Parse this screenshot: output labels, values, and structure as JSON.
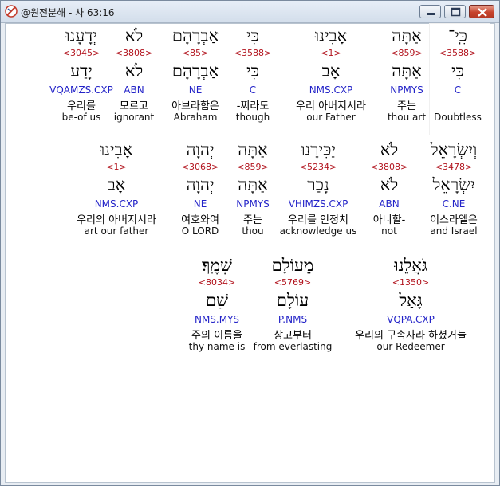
{
  "window": {
    "title": "@원전분해 - 사 63:16",
    "buttons": {
      "minimize": "minimize",
      "maximize": "maximize",
      "close": "close"
    },
    "accent": "#c7442d"
  },
  "colors": {
    "strong": "#b2141e",
    "morph": "#2323c8"
  },
  "rows": [
    {
      "words": [
        {
          "heb": "כִּֽי־",
          "strong": "<3588>",
          "lex": "כִּי",
          "morph": "C",
          "kor": "",
          "eng": "Doubtless"
        },
        {
          "heb": "אַתָּה",
          "strong": "<859>",
          "lex": "אַתָּה",
          "morph": "NPMYS",
          "kor": "주는",
          "eng": "thou art"
        },
        {
          "heb": "אָבִינוּ",
          "strong": "<1>",
          "lex": "אָב",
          "morph": "NMS.CXP",
          "kor": "우리 아버지시라",
          "eng": "our Father"
        },
        {
          "heb": "כִּי",
          "strong": "<3588>",
          "lex": "כִּי",
          "morph": "C",
          "kor": "-찌라도",
          "eng": "though"
        },
        {
          "heb": "אַבְרָהָם",
          "strong": "<85>",
          "lex": "אַבְרָהָם",
          "morph": "NE",
          "kor": "아브라함은",
          "eng": "Abraham"
        },
        {
          "heb": "לֹא",
          "strong": "<3808>",
          "lex": "לֹא",
          "morph": "ABN",
          "kor": "모르고",
          "eng": "ignorant"
        },
        {
          "heb": "יְדָעָנוּ",
          "strong": "<3045>",
          "lex": "יָדַע",
          "morph": "VQAMZS.CXP",
          "kor": "우리를",
          "eng": "be-of us"
        }
      ]
    },
    {
      "words": [
        {
          "heb": "וְיִשְׂרָאֵל",
          "strong": "<3478>",
          "lex": "יִשְׂרָאֵל",
          "morph": "C.NE",
          "kor": "이스라엘은",
          "eng": "and Israel"
        },
        {
          "heb": "לֹא",
          "strong": "<3808>",
          "lex": "לֹא",
          "morph": "ABN",
          "kor": "아니할-",
          "eng": "not"
        },
        {
          "heb": "יַכִּירָנוּ",
          "strong": "<5234>",
          "lex": "נָכַר",
          "morph": "VHIMZS.CXP",
          "kor": "우리를 인정치",
          "eng": "acknowledge us"
        },
        {
          "heb": "אַתָּה",
          "strong": "<859>",
          "lex": "אַתָּה",
          "morph": "NPMYS",
          "kor": "주는",
          "eng": "thou"
        },
        {
          "heb": "יְהוָה",
          "strong": "<3068>",
          "lex": "יְהוָה",
          "morph": "NE",
          "kor": "여호와여",
          "eng": "O LORD"
        },
        {
          "heb": "אָבִינוּ",
          "strong": "<1>",
          "lex": "אָב",
          "morph": "NMS.CXP",
          "kor": "우리의 아버지시라",
          "eng": "art our father"
        }
      ]
    },
    {
      "words": [
        {
          "heb": "גֹּאֲלֵנוּ",
          "strong": "<1350>",
          "lex": "גָּאַל",
          "morph": "VQPA.CXP",
          "kor": "우리의 구속자라 하셨거늘",
          "eng": "our Redeemer"
        },
        {
          "heb": "מֵעוֹלָם",
          "strong": "<5769>",
          "lex": "עוֹלָם",
          "morph": "P.NMS",
          "kor": "상고부터",
          "eng": "from everlasting"
        },
        {
          "heb": "שְׁמֶֽךָ׃",
          "strong": "<8034>",
          "lex": "שֵׁם",
          "morph": "NMS.MYS",
          "kor": "주의 이름을",
          "eng": "thy name is"
        }
      ]
    }
  ]
}
